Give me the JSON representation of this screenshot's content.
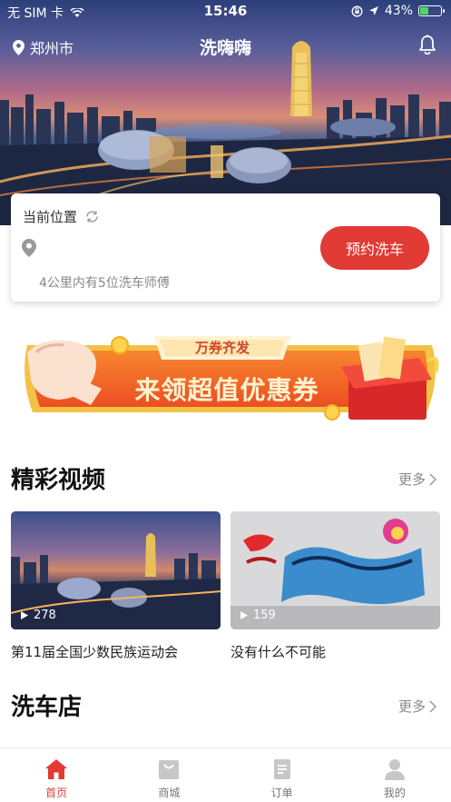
{
  "status_bar": {
    "carrier": "无 SIM 卡",
    "time": "15:46",
    "battery": "43%",
    "battery_level": 0.43,
    "icons": [
      "wifi-icon",
      "lock-rotation-icon",
      "location-arrow-icon",
      "battery-icon"
    ]
  },
  "header": {
    "city": "郑州市",
    "title": "洗嗨嗨",
    "icons": [
      "location-pin-icon",
      "bell-icon"
    ]
  },
  "location_card": {
    "label": "当前位置",
    "nearby_info": "4公里内有5位洗车师傅",
    "book_button": "预约洗车",
    "icons": [
      "refresh-icon",
      "map-pin-icon"
    ]
  },
  "banner": {
    "tag": "万券齐发",
    "headline": "来领超值优惠券"
  },
  "videos": {
    "title": "精彩视频",
    "more": "更多",
    "items": [
      {
        "plays": "278",
        "title": "第11届全国少数民族运动会"
      },
      {
        "plays": "159",
        "title": "没有什么不可能"
      }
    ]
  },
  "shops": {
    "title": "洗车店",
    "more": "更多"
  },
  "tabbar": {
    "items": [
      {
        "label": "首页",
        "icon": "home-icon",
        "active": true
      },
      {
        "label": "商城",
        "icon": "shopping-bag-icon",
        "active": false
      },
      {
        "label": "订单",
        "icon": "order-list-icon",
        "active": false
      },
      {
        "label": "我的",
        "icon": "person-icon",
        "active": false
      }
    ]
  },
  "colors": {
    "accent": "#e23a34",
    "banner_orange": "#f06a2a"
  }
}
